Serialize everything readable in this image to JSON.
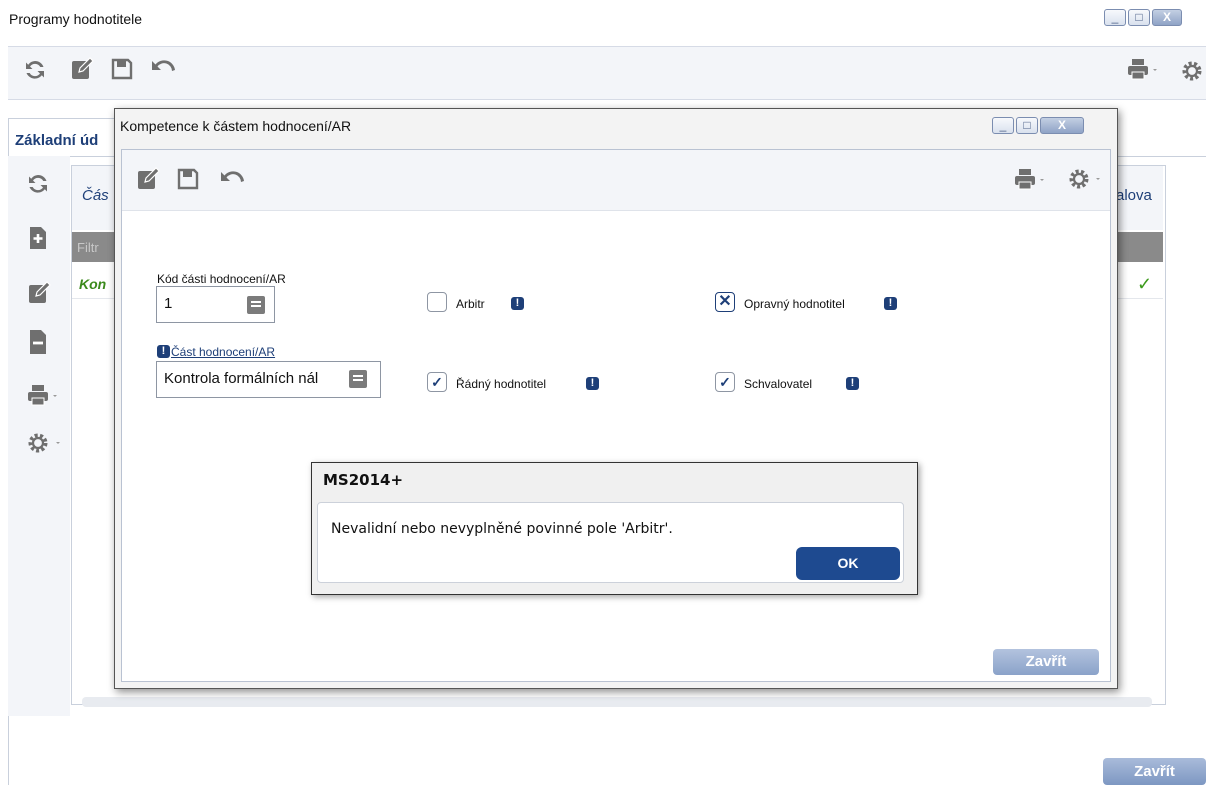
{
  "outer_window": {
    "title": "Programy hodnotitele",
    "tab_label": "Základní úd",
    "grid_title_left": "Čás",
    "grid_title_right": "alova",
    "grid_filter_label": "Filtr",
    "grid_row_text": "Kon",
    "grid_row_check": "✓",
    "close_label": "Zavřít"
  },
  "modal": {
    "title": "Kompetence k částem hodnocení/AR",
    "code_label": "Kód části hodnocení/AR",
    "code_value": "1",
    "part_label": "Část hodnocení/AR",
    "part_value": "Kontrola formálních nál",
    "checkboxes": [
      {
        "label": "Arbitr",
        "state": "unchecked"
      },
      {
        "label": "Opravný hodnotitel",
        "state": "x"
      },
      {
        "label": "Řádný hodnotitel",
        "state": "checked"
      },
      {
        "label": "Schvalovatel",
        "state": "checked"
      }
    ],
    "close_label": "Zavřít"
  },
  "message": {
    "title": "MS2014+",
    "text": "Nevalidní nebo nevyplněné povinné pole 'Arbitr'.",
    "ok_label": "OK"
  },
  "window_buttons": {
    "minimize": "_",
    "maximize": "□",
    "close": "X"
  },
  "checkbox_marks": {
    "checked": "✓",
    "x": "✕"
  },
  "info_glyph": "!",
  "colors": {
    "accent": "#1e3f78",
    "ok_button": "#1e4a90",
    "row_green": "#3c8a1c",
    "filter_bar": "#8a8a8a"
  }
}
